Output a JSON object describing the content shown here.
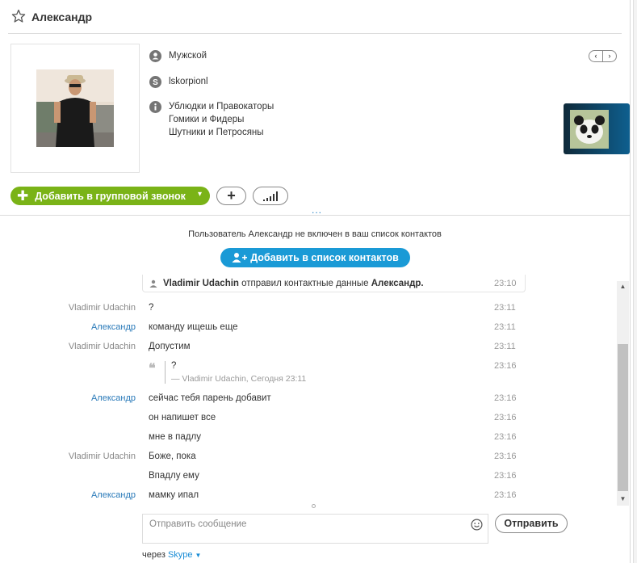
{
  "header": {
    "contact_name": "Александр"
  },
  "profile": {
    "gender": "Мужской",
    "skype_name": "lskorpionl",
    "about_lines": [
      "Ублюдки и Правокаторы",
      "Гомики и Фидеры",
      "Шутники и Петросяны"
    ],
    "pager_prev": "‹",
    "pager_next": "›"
  },
  "actions": {
    "add_to_call_label": "Добавить в групповой звонок",
    "add_to_call_chevron": "▾",
    "add_button": "+",
    "expand_handle": "..."
  },
  "notice": {
    "text": "Пользователь Александр не включен в ваш список контактов",
    "add_contact_label": "Добавить в список контактов"
  },
  "system_message": {
    "sender": "Vladimir Udachin",
    "middle": " отправил контактные данные ",
    "target": "Александр.",
    "time": "23:10"
  },
  "messages": [
    {
      "sender": "Vladimir Udachin",
      "text": "?",
      "time": "23:11"
    },
    {
      "sender": "Александр",
      "text": "команду ищешь еще",
      "time": "23:11"
    },
    {
      "sender": "Vladimir Udachin",
      "text": "Допустим",
      "time": "23:11"
    },
    {
      "sender": "",
      "text": "",
      "time": "23:16"
    },
    {
      "sender": "Александр",
      "text": "сейчас тебя парень добавит",
      "time": "23:16"
    },
    {
      "sender": "",
      "text": "он напишет все",
      "time": "23:16"
    },
    {
      "sender": "",
      "text": "мне в падлу",
      "time": "23:16"
    },
    {
      "sender": "Vladimir Udachin",
      "text": "Боже, пока",
      "time": "23:16"
    },
    {
      "sender": "",
      "text": "Впадлу ему",
      "time": "23:16"
    },
    {
      "sender": "Александр",
      "text": "мамку ипал",
      "time": "23:16"
    }
  ],
  "quote": {
    "text": "?",
    "source": "— Vladimir Udachin, Сегодня 23:11"
  },
  "composer": {
    "placeholder": "Отправить сообщение",
    "send_label": "Отправить",
    "via_prefix": "через ",
    "via_service": "Skype"
  },
  "colors": {
    "call_green": "#7ab317",
    "add_blue": "#1a9ad6",
    "sender_blue": "#2a7ab9"
  }
}
